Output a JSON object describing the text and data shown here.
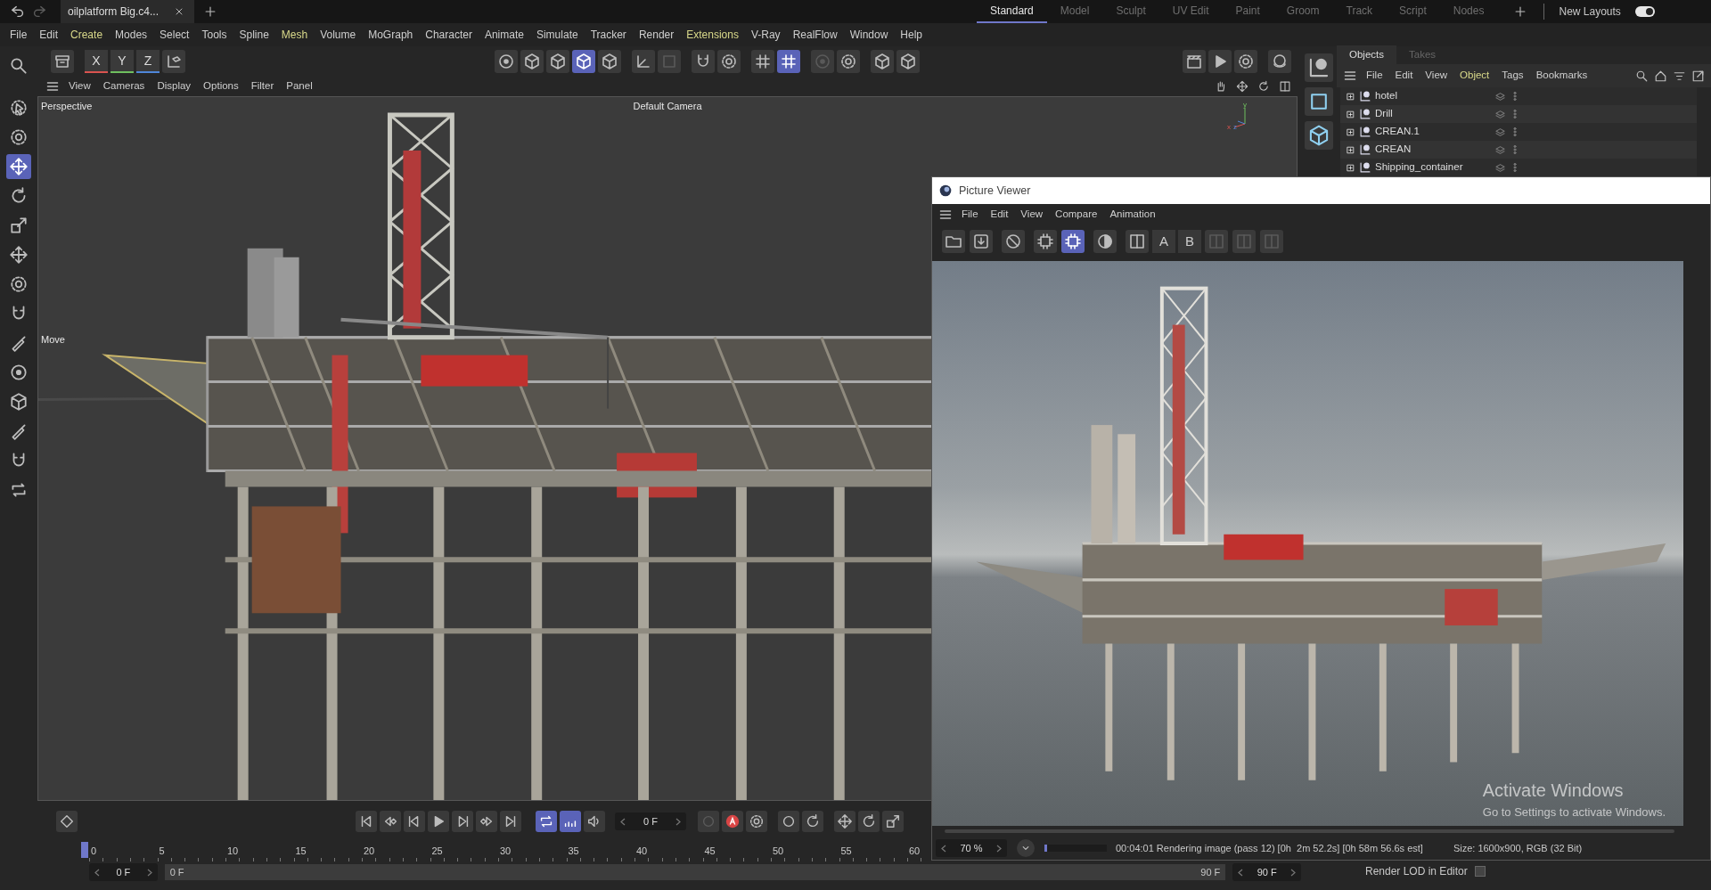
{
  "title_bar": {
    "document_tab": "oilplatform Big.c4...",
    "layouts": [
      {
        "label": "Standard",
        "selected": true
      },
      {
        "label": "Model",
        "selected": false
      },
      {
        "label": "Sculpt",
        "selected": false
      },
      {
        "label": "UV Edit",
        "selected": false
      },
      {
        "label": "Paint",
        "selected": false
      },
      {
        "label": "Groom",
        "selected": false
      },
      {
        "label": "Track",
        "selected": false
      },
      {
        "label": "Script",
        "selected": false
      },
      {
        "label": "Nodes",
        "selected": false
      }
    ],
    "new_layouts": {
      "label": "New Layouts",
      "on": true
    }
  },
  "menu_bar": [
    {
      "label": "File",
      "highlighted": false
    },
    {
      "label": "Edit",
      "highlighted": false
    },
    {
      "label": "Create",
      "highlighted": true
    },
    {
      "label": "Modes",
      "highlighted": false
    },
    {
      "label": "Select",
      "highlighted": false
    },
    {
      "label": "Tools",
      "highlighted": false
    },
    {
      "label": "Spline",
      "highlighted": false
    },
    {
      "label": "Mesh",
      "highlighted": true
    },
    {
      "label": "Volume",
      "highlighted": false
    },
    {
      "label": "MoGraph",
      "highlighted": false
    },
    {
      "label": "Character",
      "highlighted": false
    },
    {
      "label": "Animate",
      "highlighted": false
    },
    {
      "label": "Simulate",
      "highlighted": false
    },
    {
      "label": "Tracker",
      "highlighted": false
    },
    {
      "label": "Render",
      "highlighted": false
    },
    {
      "label": "Extensions",
      "highlighted": true
    },
    {
      "label": "V-Ray",
      "highlighted": false
    },
    {
      "label": "RealFlow",
      "highlighted": false
    },
    {
      "label": "Window",
      "highlighted": false
    },
    {
      "label": "Help",
      "highlighted": false
    }
  ],
  "toolbar": {
    "axes": [
      {
        "label": "X",
        "color": "#d9534f"
      },
      {
        "label": "Y",
        "color": "#6fbf5f"
      },
      {
        "label": "Z",
        "color": "#4f86d9"
      }
    ],
    "modes": [
      {
        "selected": false
      },
      {
        "selected": false
      },
      {
        "selected": false
      },
      {
        "selected": true
      },
      {
        "selected": false
      }
    ],
    "snapping": [
      {
        "selected": false
      },
      {
        "selected": true
      }
    ]
  },
  "tool_palette": [
    {
      "selected": false
    },
    {
      "selected": false
    },
    {
      "selected": false
    },
    {
      "selected": true
    },
    {
      "selected": false
    },
    {
      "selected": false
    },
    {
      "selected": false
    },
    {
      "selected": false
    },
    {
      "selected": false
    },
    {
      "selected": false
    },
    {
      "selected": false
    },
    {
      "selected": false
    },
    {
      "selected": false
    },
    {
      "selected": false
    },
    {
      "selected": false
    }
  ],
  "viewport": {
    "menu": [
      "View",
      "Cameras",
      "Display",
      "Options",
      "Filter",
      "Panel"
    ],
    "view_name": "Perspective",
    "camera": "Default Camera",
    "active_tool": "Move",
    "axis_gizmo": [
      "y",
      "x",
      "z"
    ]
  },
  "objects_panel": {
    "tabs": [
      {
        "label": "Objects",
        "selected": true
      },
      {
        "label": "Takes",
        "selected": false
      }
    ],
    "menu": [
      {
        "label": "File",
        "highlighted": false
      },
      {
        "label": "Edit",
        "highlighted": false
      },
      {
        "label": "View",
        "highlighted": false
      },
      {
        "label": "Object",
        "highlighted": true
      },
      {
        "label": "Tags",
        "highlighted": false
      },
      {
        "label": "Bookmarks",
        "highlighted": false
      }
    ],
    "objects": [
      "hotel",
      "Drill",
      "CREAN.1",
      "CREAN",
      "Shipping_container"
    ]
  },
  "picture_viewer": {
    "title": "Picture Viewer",
    "menu": [
      "File",
      "Edit",
      "View",
      "Compare",
      "Animation"
    ],
    "tools": [
      {
        "selected": false
      },
      {
        "selected": false
      },
      {
        "selected": false
      },
      {
        "selected": false
      },
      {
        "selected": true
      },
      {
        "selected": false
      },
      {
        "selected": false
      }
    ],
    "compare_labels": [
      "A",
      "B"
    ],
    "compare_tools": [
      {
        "disabled": true
      },
      {
        "disabled": true
      },
      {
        "disabled": true
      }
    ],
    "zoom": "70 %",
    "progress": {
      "level": 0.04
    },
    "status": "00:04:01 Rendering image (pass 12) [0h  2m 52.2s] [0h 58m 56.6s est]",
    "image_info": "Size: 1600x900, RGB (32 Bit)"
  },
  "timeline": {
    "current_frame": "0 F",
    "transport": [
      {
        "selected": false
      },
      {
        "selected": false
      },
      {
        "selected": false
      },
      {
        "selected": false
      },
      {
        "selected": false
      },
      {
        "selected": false
      },
      {
        "selected": false
      },
      {
        "selected": true
      },
      {
        "selected": true
      },
      {
        "selected": false
      }
    ],
    "ruler": [
      "0",
      "5",
      "10",
      "15",
      "20",
      "25",
      "30",
      "35",
      "40",
      "45",
      "50",
      "55",
      "60"
    ],
    "start_frame": "0 F",
    "range_start": "0 F",
    "range_end": "90 F",
    "end_frame": "90 F"
  },
  "attributes": {
    "render_lod": {
      "label": "Render LOD in Editor",
      "checked": false
    }
  },
  "system_notice": [
    "Activate Windows",
    "Go to Settings to activate Windows."
  ]
}
